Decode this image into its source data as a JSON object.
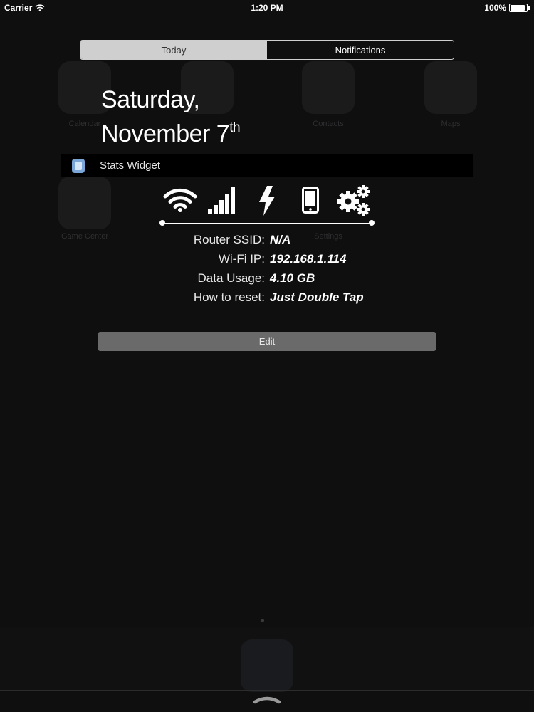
{
  "status_bar": {
    "carrier": "Carrier",
    "time": "1:20 PM",
    "battery": "100%",
    "battery_level": 1.0
  },
  "tabs": [
    {
      "label": "Today",
      "active": true
    },
    {
      "label": "Notifications",
      "active": false
    }
  ],
  "date": {
    "weekday": "Saturday,",
    "month_day": "November 7",
    "suffix": "th"
  },
  "widget": {
    "title": "Stats Widget",
    "icons": [
      "wifi-icon",
      "cellular-signal-icon",
      "lightning-bolt-icon",
      "phone-icon",
      "gears-icon"
    ],
    "rows": [
      {
        "label": "Router SSID:",
        "value": "N/A"
      },
      {
        "label": "Wi-Fi IP:",
        "value": "192.168.1.114"
      },
      {
        "label": "Data Usage:",
        "value": "4.10 GB"
      },
      {
        "label": "How to reset:",
        "value": "Just Double Tap"
      }
    ]
  },
  "edit_button": "Edit",
  "background_icon_labels": [
    "Calendar",
    "Contacts",
    "Maps",
    "Game Center",
    "Settings"
  ],
  "colors": {
    "background": "#0f0f10",
    "segment_active": "#cfcfcf",
    "edit_button": "#6a6a6a"
  }
}
